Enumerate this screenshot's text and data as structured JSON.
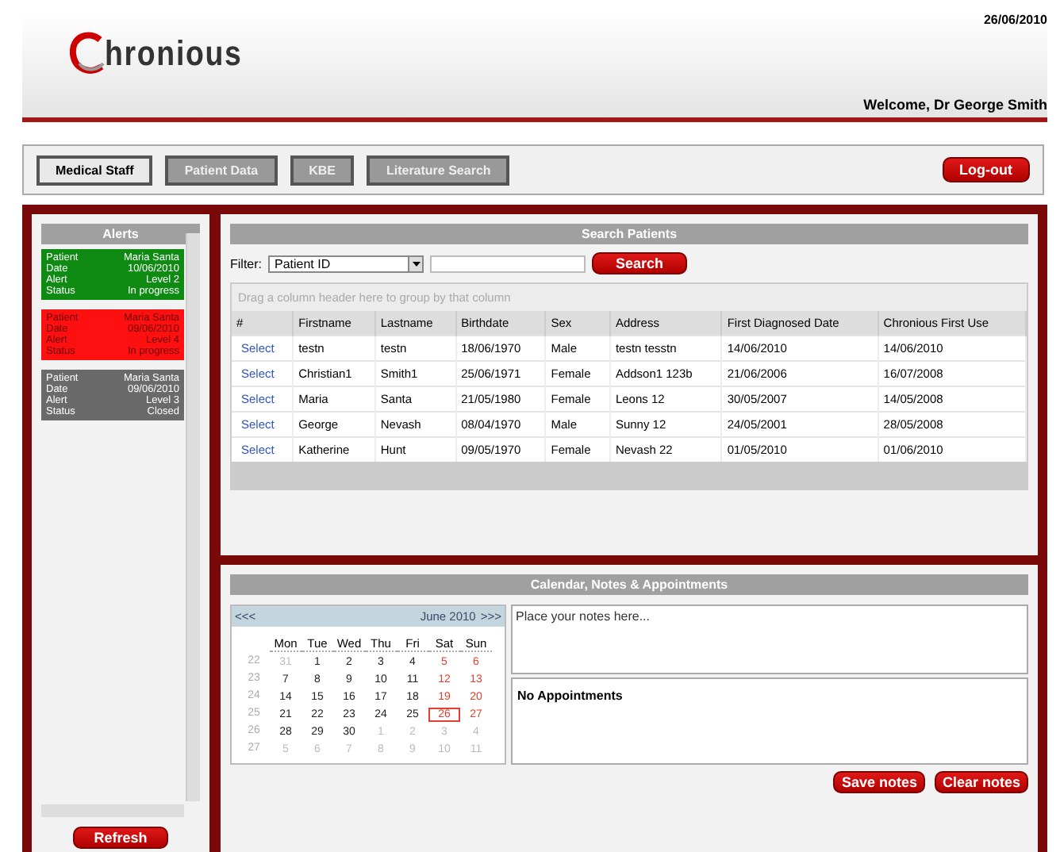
{
  "header": {
    "logo": "hronious",
    "date": "26/06/2010",
    "welcome": "Welcome, Dr George Smith"
  },
  "nav": {
    "tabs": [
      {
        "label": "Medical Staff",
        "selected": true
      },
      {
        "label": "Patient Data",
        "selected": false
      },
      {
        "label": "KBE",
        "selected": false
      },
      {
        "label": "Literature Search",
        "selected": false
      }
    ],
    "logout": "Log-out"
  },
  "alerts": {
    "title": "Alerts",
    "items": [
      {
        "color": "#0f8a12",
        "fields": [
          {
            "label": "Patient",
            "value": "Maria Santa"
          },
          {
            "label": "Date",
            "value": "10/06/2010"
          },
          {
            "label": "Alert",
            "value": "Level 2"
          },
          {
            "label": "Status",
            "value": "In progress"
          }
        ]
      },
      {
        "color": "#ff1010",
        "fields": [
          {
            "label": "Patient",
            "value": "Maria Santa"
          },
          {
            "label": "Date",
            "value": "09/06/2010"
          },
          {
            "label": "Alert",
            "value": "Level 4"
          },
          {
            "label": "Status",
            "value": "In progress"
          }
        ]
      },
      {
        "color": "#6a6a6a",
        "fields": [
          {
            "label": "Patient",
            "value": "Maria Santa"
          },
          {
            "label": "Date",
            "value": "09/06/2010"
          },
          {
            "label": "Alert",
            "value": "Level 3"
          },
          {
            "label": "Status",
            "value": "Closed"
          }
        ]
      }
    ],
    "refresh": "Refresh"
  },
  "search": {
    "title": "Search Patients",
    "filter_label": "Filter:",
    "filter_value": "Patient ID",
    "button": "Search",
    "group_hint": "Drag a column header here to group by that column",
    "columns": [
      "#",
      "Firstname",
      "Lastname",
      "Birthdate",
      "Sex",
      "Address",
      "First Diagnosed Date",
      "Chronious First Use"
    ],
    "rows": [
      [
        "Select",
        "testn",
        "testn",
        "18/06/1970",
        "Male",
        "testn tesstn",
        "14/06/2010",
        "14/06/2010"
      ],
      [
        "Select",
        "Christian1",
        "Smith1",
        "25/06/1971",
        "Female",
        "Addson1 123b",
        "21/06/2006",
        "16/07/2008"
      ],
      [
        "Select",
        "Maria",
        "Santa",
        "21/05/1980",
        "Female",
        "Leons 12",
        "30/05/2007",
        "14/05/2008"
      ],
      [
        "Select",
        "George",
        "Nevash",
        "08/04/1970",
        "Male",
        "Sunny 12",
        "24/05/2001",
        "28/05/2008"
      ],
      [
        "Select",
        "Katherine",
        "Hunt",
        "09/05/1970",
        "Female",
        "Nevash 22",
        "01/05/2010",
        "01/06/2010"
      ]
    ]
  },
  "calendar": {
    "title": "Calendar, Notes & Appointments",
    "prev": "<<<",
    "month": "June 2010",
    "next": ">>>",
    "weekdays": [
      "Mon",
      "Tue",
      "Wed",
      "Thu",
      "Fri",
      "Sat",
      "Sun"
    ],
    "weeks": [
      {
        "number": "22",
        "days": [
          {
            "day": "31",
            "kind": "other",
            "selected": false
          },
          {
            "day": "1",
            "kind": "day",
            "selected": false
          },
          {
            "day": "2",
            "kind": "day",
            "selected": false
          },
          {
            "day": "3",
            "kind": "day",
            "selected": false
          },
          {
            "day": "4",
            "kind": "day",
            "selected": false
          },
          {
            "day": "5",
            "kind": "weekend",
            "selected": false
          },
          {
            "day": "6",
            "kind": "weekend",
            "selected": false
          }
        ]
      },
      {
        "number": "23",
        "days": [
          {
            "day": "7",
            "kind": "day",
            "selected": false
          },
          {
            "day": "8",
            "kind": "day",
            "selected": false
          },
          {
            "day": "9",
            "kind": "day",
            "selected": false
          },
          {
            "day": "10",
            "kind": "day",
            "selected": false
          },
          {
            "day": "11",
            "kind": "day",
            "selected": false
          },
          {
            "day": "12",
            "kind": "weekend",
            "selected": false
          },
          {
            "day": "13",
            "kind": "weekend",
            "selected": false
          }
        ]
      },
      {
        "number": "24",
        "days": [
          {
            "day": "14",
            "kind": "day",
            "selected": false
          },
          {
            "day": "15",
            "kind": "day",
            "selected": false
          },
          {
            "day": "16",
            "kind": "day",
            "selected": false
          },
          {
            "day": "17",
            "kind": "day",
            "selected": false
          },
          {
            "day": "18",
            "kind": "day",
            "selected": false
          },
          {
            "day": "19",
            "kind": "weekend",
            "selected": false
          },
          {
            "day": "20",
            "kind": "weekend",
            "selected": false
          }
        ]
      },
      {
        "number": "25",
        "days": [
          {
            "day": "21",
            "kind": "day",
            "selected": false
          },
          {
            "day": "22",
            "kind": "day",
            "selected": false
          },
          {
            "day": "23",
            "kind": "day",
            "selected": false
          },
          {
            "day": "24",
            "kind": "day",
            "selected": false
          },
          {
            "day": "25",
            "kind": "day",
            "selected": false
          },
          {
            "day": "26",
            "kind": "weekend",
            "selected": true
          },
          {
            "day": "27",
            "kind": "weekend",
            "selected": false
          }
        ]
      },
      {
        "number": "26",
        "days": [
          {
            "day": "28",
            "kind": "day",
            "selected": false
          },
          {
            "day": "29",
            "kind": "day",
            "selected": false
          },
          {
            "day": "30",
            "kind": "day",
            "selected": false
          },
          {
            "day": "1",
            "kind": "other",
            "selected": false
          },
          {
            "day": "2",
            "kind": "other",
            "selected": false
          },
          {
            "day": "3",
            "kind": "other",
            "selected": false
          },
          {
            "day": "4",
            "kind": "other",
            "selected": false
          }
        ]
      },
      {
        "number": "27",
        "days": [
          {
            "day": "5",
            "kind": "other",
            "selected": false
          },
          {
            "day": "6",
            "kind": "other",
            "selected": false
          },
          {
            "day": "7",
            "kind": "other",
            "selected": false
          },
          {
            "day": "8",
            "kind": "other",
            "selected": false
          },
          {
            "day": "9",
            "kind": "other",
            "selected": false
          },
          {
            "day": "10",
            "kind": "other",
            "selected": false
          },
          {
            "day": "11",
            "kind": "other",
            "selected": false
          }
        ]
      }
    ],
    "notes_placeholder": "Place your notes here...",
    "appointments": "No Appointments",
    "buttons": [
      "Save notes",
      "Clear notes"
    ]
  }
}
